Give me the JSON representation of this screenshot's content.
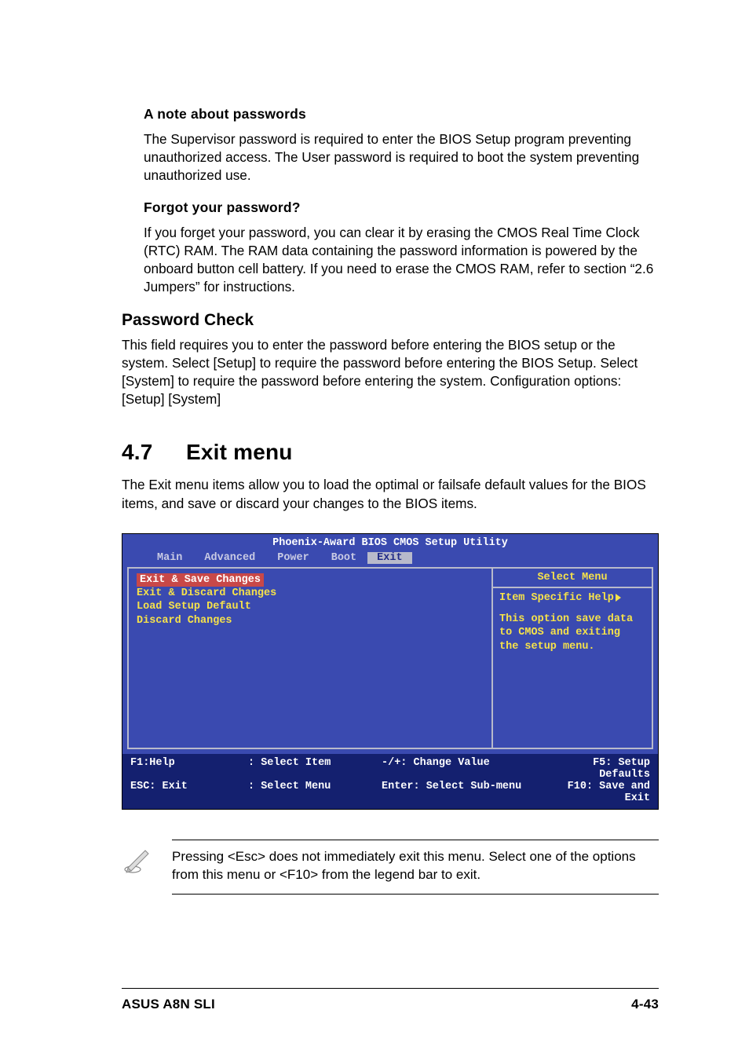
{
  "section1": {
    "heading": "A note about passwords",
    "text": "The Supervisor password is required to enter the BIOS Setup program preventing unauthorized access. The User password is required to boot the system preventing unauthorized use."
  },
  "section2": {
    "heading": "Forgot your password?",
    "text": "If you forget your password, you can clear it by erasing the CMOS Real Time Clock (RTC) RAM. The RAM data containing the password information is powered by the onboard button cell battery. If you need to erase the CMOS RAM, refer to section “2.6 Jumpers” for instructions."
  },
  "section3": {
    "heading": "Password Check",
    "text": "This field requires you to enter the password before entering the BIOS setup or the system. Select [Setup] to require the password before entering the BIOS Setup. Select [System] to require the password before entering the system. Configuration options: [Setup] [System]"
  },
  "section4": {
    "number": "4.7",
    "title": "Exit menu",
    "text": "The Exit menu items allow you to load the optimal or failsafe default values for the BIOS items, and save or discard your changes to the BIOS items."
  },
  "bios": {
    "title": "Phoenix-Award BIOS CMOS Setup Utility",
    "tabs": [
      "Main",
      "Advanced",
      "Power",
      "Boot",
      "Exit"
    ],
    "active_tab": "Exit",
    "items": [
      "Exit & Save Changes",
      "Exit & Discard Changes",
      "Load Setup Default",
      "Discard Changes"
    ],
    "selected_index": 0,
    "help_panel_title": "Select Menu",
    "help_title": "Item Specific Help",
    "help_text": "This option save data to CMOS and exiting the setup menu.",
    "legend": {
      "c1a": "F1:Help",
      "c1b": "ESC: Exit",
      "c2a": ": Select Item",
      "c2b": ": Select Menu",
      "c3a": "-/+: Change Value",
      "c3b": "Enter: Select Sub-menu",
      "c4a": "F5: Setup Defaults",
      "c4b": "F10: Save and Exit"
    }
  },
  "note": {
    "text": "Pressing <Esc> does not immediately exit this menu. Select one of the options from this menu or <F10> from the legend bar to exit."
  },
  "footer": {
    "left": "ASUS A8N SLI",
    "right": "4-43"
  }
}
